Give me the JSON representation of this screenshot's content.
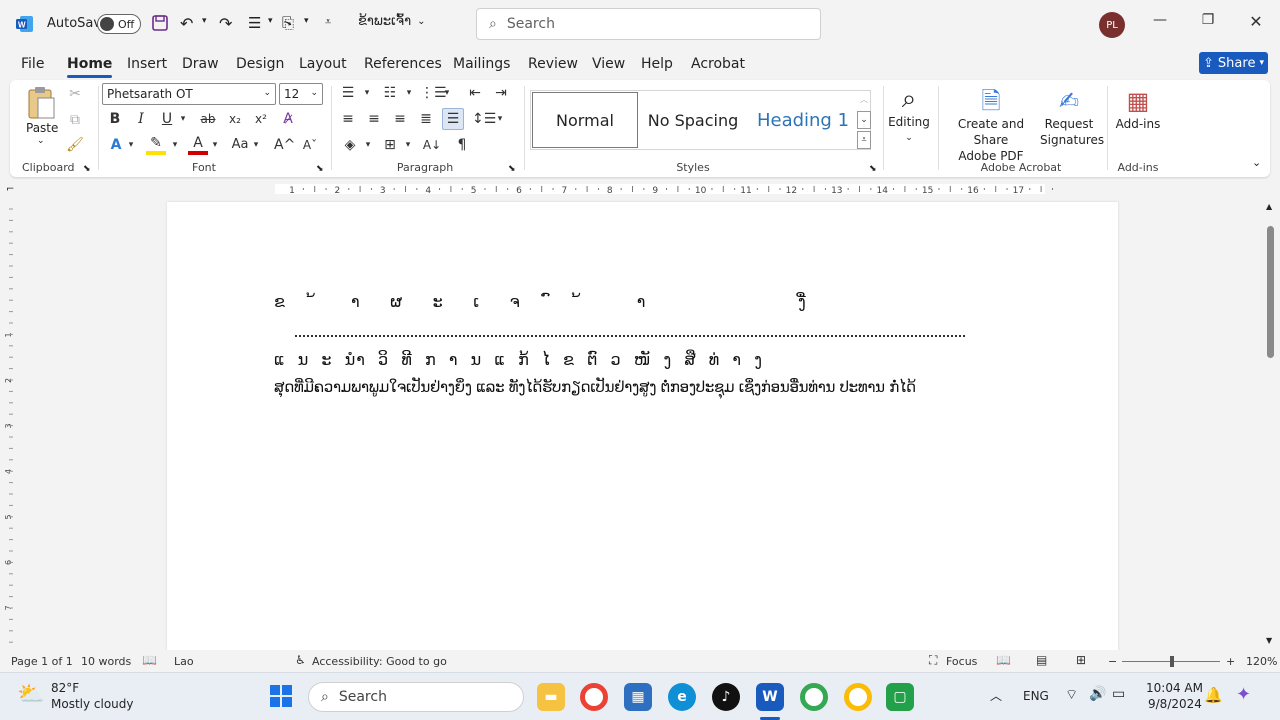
{
  "titlebar": {
    "autosave_label": "AutoSave",
    "autosave_state": "Off",
    "doc_title": "ຂ້າພະເຈົ້າ",
    "search_placeholder": "Search",
    "avatar_initials": "PL"
  },
  "tabs": [
    "File",
    "Home",
    "Insert",
    "Draw",
    "Design",
    "Layout",
    "References",
    "Mailings",
    "Review",
    "View",
    "Help",
    "Acrobat"
  ],
  "active_tab": "Home",
  "share_label": "Share",
  "ribbon": {
    "clipboard": {
      "paste_label": "Paste",
      "group_label": "Clipboard"
    },
    "font": {
      "font_name": "Phetsarath OT",
      "font_size": "12",
      "group_label": "Font"
    },
    "paragraph": {
      "group_label": "Paragraph"
    },
    "styles": {
      "items": [
        "Normal",
        "No Spacing",
        "Heading 1"
      ],
      "group_label": "Styles"
    },
    "editing": {
      "label": "Editing"
    },
    "acrobat": {
      "create_label": "Create and Share\nAdobe PDF",
      "request_label": "Request\nSignatures",
      "group_label": "Adobe Acrobat"
    },
    "addins": {
      "label": "Add-ins",
      "group_label": "Add-ins"
    }
  },
  "ruler": {
    "numbers": [
      "1",
      "2",
      "3",
      "4",
      "5",
      "6",
      "7",
      "8",
      "9",
      "10",
      "11",
      "12",
      "13",
      "14",
      "15",
      "16",
      "17"
    ]
  },
  "vruler": {
    "numbers": [
      "1",
      "2",
      "3",
      "4",
      "5",
      "6",
      "7"
    ]
  },
  "document": {
    "line1": "ຂ      ້       າ      ຜ      ະ      ເ      ຈ      ົ      ້           າ                              ງື່",
    "line2": "ແ  ນ  ະ  ນໍາ  ວິ  ທີ  ກ  າ  ນ  ແ  ກ້  ໄ  ຂ  ຕົ  ວ  ໜັ  ງ  ສື  ທ່  າ  ງ",
    "line3": "ສຸດທີ່ມີຄວາມພາພູມໃຈເປັນຢ່າງຍິ່ງ ແລະ ທັງໄດ້ຮັບກຽດເປັນຢ່າງສູງ ຕໍ່ກອງປະຊຸມ ເຊິ່ງກ່ອນອື່ນທ່ານ ປະທານ ກໍ່ໄດ້"
  },
  "statusbar": {
    "page": "Page 1 of 1",
    "words": "10 words",
    "language": "Lao",
    "accessibility": "Accessibility: Good to go",
    "focus": "Focus",
    "zoom": "120%"
  },
  "taskbar": {
    "temp": "82°F",
    "weather": "Mostly cloudy",
    "search": "Search",
    "lang": "ENG",
    "time": "10:04 AM",
    "date": "9/8/2024"
  }
}
